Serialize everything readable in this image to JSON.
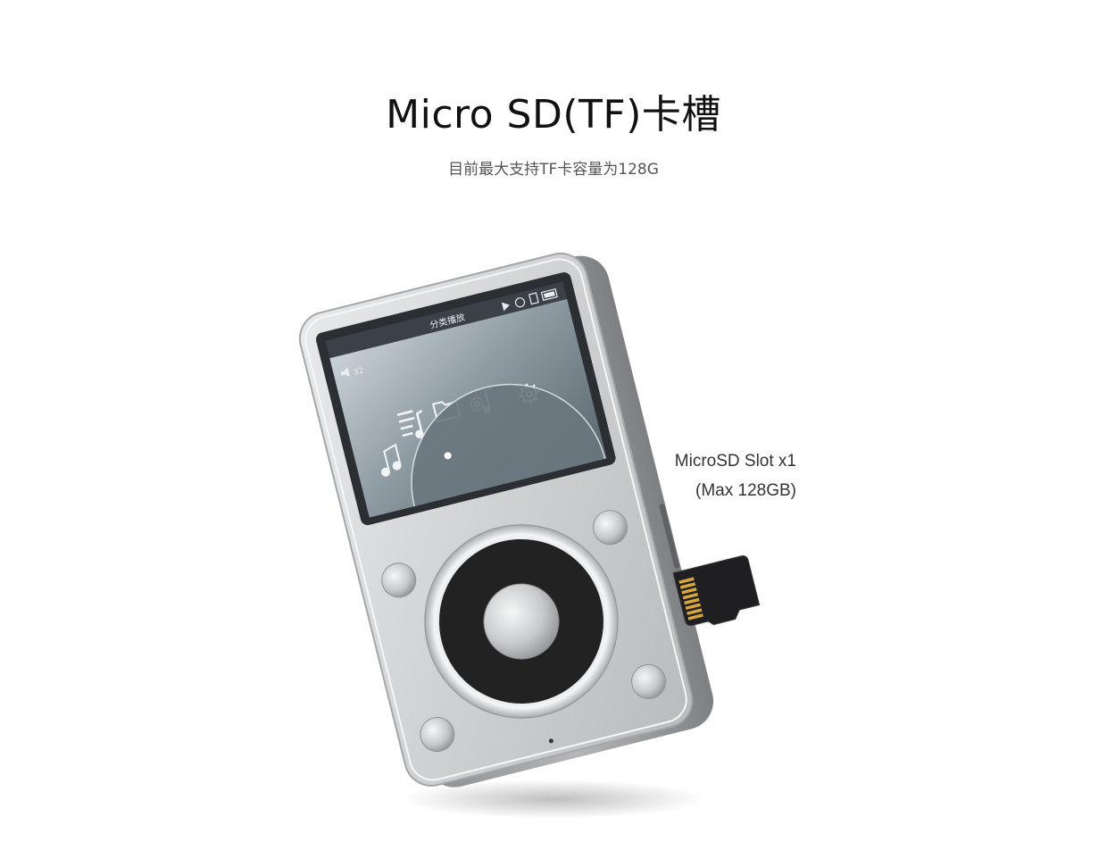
{
  "header": {
    "title": "Micro SD(TF)卡槽",
    "subtitle": "目前最大支持TF卡容量为128G"
  },
  "callout": {
    "line1": "MicroSD Slot x1",
    "line2": "(Max 128GB)"
  },
  "device_screen": {
    "menu_title": "分类播放",
    "volume_value": "32",
    "icons": [
      "volume-icon",
      "play-icon",
      "clock-icon",
      "sd-card-icon",
      "battery-icon",
      "music-note-icon",
      "playlist-icon",
      "folder-icon",
      "music-settings-icon",
      "settings-icon"
    ]
  },
  "colors": {
    "title": "#111111",
    "subtitle": "#555555",
    "caption": "#333333",
    "device_body": "#c9cbcd",
    "wheel": "#222222",
    "sd_card": "#1f1f22",
    "sd_contacts": "#d8a63a"
  }
}
